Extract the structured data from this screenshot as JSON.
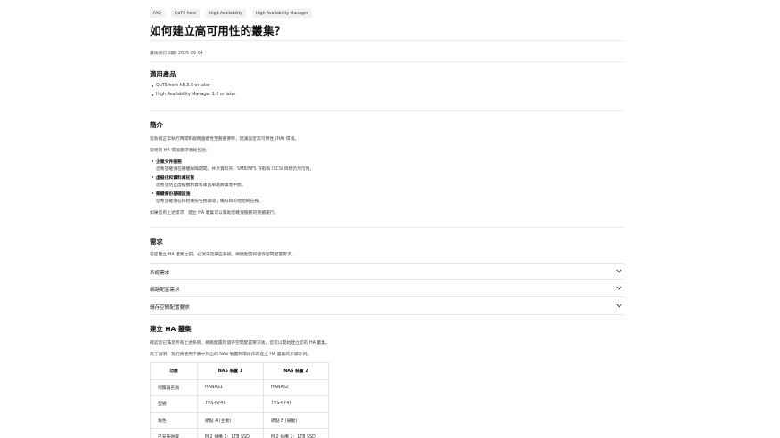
{
  "breadcrumbs": [
    "FAQ",
    "QuTS hero",
    "High Availability",
    "High Availability Manager"
  ],
  "page_title": "如何建立高可用性的叢集？",
  "last_modified": "最後修訂日期: 2025-09-04",
  "applicable": {
    "heading": "適用產品",
    "items": [
      "QuTS hero h5.3.0 or later",
      "High Availability Manager 1.0 or later"
    ]
  },
  "intro": {
    "heading": "簡介",
    "para1": "當系統正常執行時間和服務連續性至關重要時，建議設定高可用性 (HA) 環境。",
    "para2": "常見的 HA 環境需求情境包括：",
    "items": [
      {
        "title": "企業文件服務",
        "desc": "您希望確保在硬體故障期間，共享資料夾、SMB/NFS 存取和 iSCSI 目標仍然可用。"
      },
      {
        "title": "虛擬化和資料庫託管",
        "desc": "您希望防止虛擬機和資料庫因單點故障而中斷。"
      },
      {
        "title": "關鍵備份基礎設施",
        "desc": "您希望確保在排程備份任務期間，備份目的地始終在線。"
      }
    ],
    "para3": "如果您有上述需求，建立 HA 叢集可以幫助您確保服務的持續運行。"
  },
  "requirements": {
    "heading": "需求",
    "para": "在您建立 HA 叢集之前，必須滿足某些系統、網路配置和儲存空間配置需求。",
    "accordions": [
      "系統需求",
      "網路配置需求",
      "儲存空間配置要求"
    ]
  },
  "build": {
    "heading": "建立 HA 叢集",
    "para1": "確認您已滿足所有上述系統、網路配置和儲存空間配置要求後，您可以開始建立您的 HA 叢集。",
    "para2": "為了說明，我們將使用下表中列出的 NAS 裝置和環境作為建立 HA 叢集的步驟示例。",
    "table": {
      "headers": [
        "功能",
        "NAS 裝置 1",
        "NAS 裝置 2"
      ],
      "rows": [
        [
          "伺服器名稱",
          "HANAS1",
          "HANAS2"
        ],
        [
          "型號",
          "TVS-674T",
          "TVS-674T"
        ],
        [
          "角色",
          "節點 A (主動)",
          "節點 B (被動)"
        ],
        [
          "已安裝磁碟",
          "M.2 插槽 1：1TB SSD",
          "M.2 插槽 1：1TB SSD"
        ]
      ]
    }
  },
  "icons": {
    "accordion_toggle": "chevron-down-icon"
  }
}
